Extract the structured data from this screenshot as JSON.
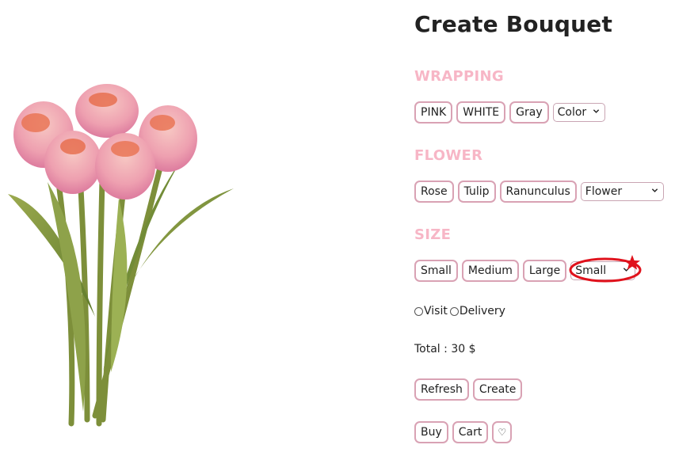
{
  "page": {
    "title": "Create Bouquet"
  },
  "wrapping": {
    "label": "WRAPPING",
    "options": [
      "PINK",
      "WHITE",
      "Gray"
    ],
    "select_value": "Color"
  },
  "flower": {
    "label": "FLOWER",
    "options": [
      "Rose",
      "Tulip",
      "Ranunculus"
    ],
    "select_value": "Flower"
  },
  "size": {
    "label": "SIZE",
    "options": [
      "Small",
      "Medium",
      "Large"
    ],
    "select_value": "Small"
  },
  "receive": {
    "visit": "Visit",
    "delivery": "Delivery"
  },
  "total": "Total : 30 $",
  "actions": {
    "refresh": "Refresh",
    "create": "Create",
    "buy": "Buy",
    "cart": "Cart",
    "wish": "♡"
  },
  "colors": {
    "accent_pink": "#f7b6c6",
    "button_border": "#d9a2b4",
    "annotation_red": "#e0121c"
  }
}
